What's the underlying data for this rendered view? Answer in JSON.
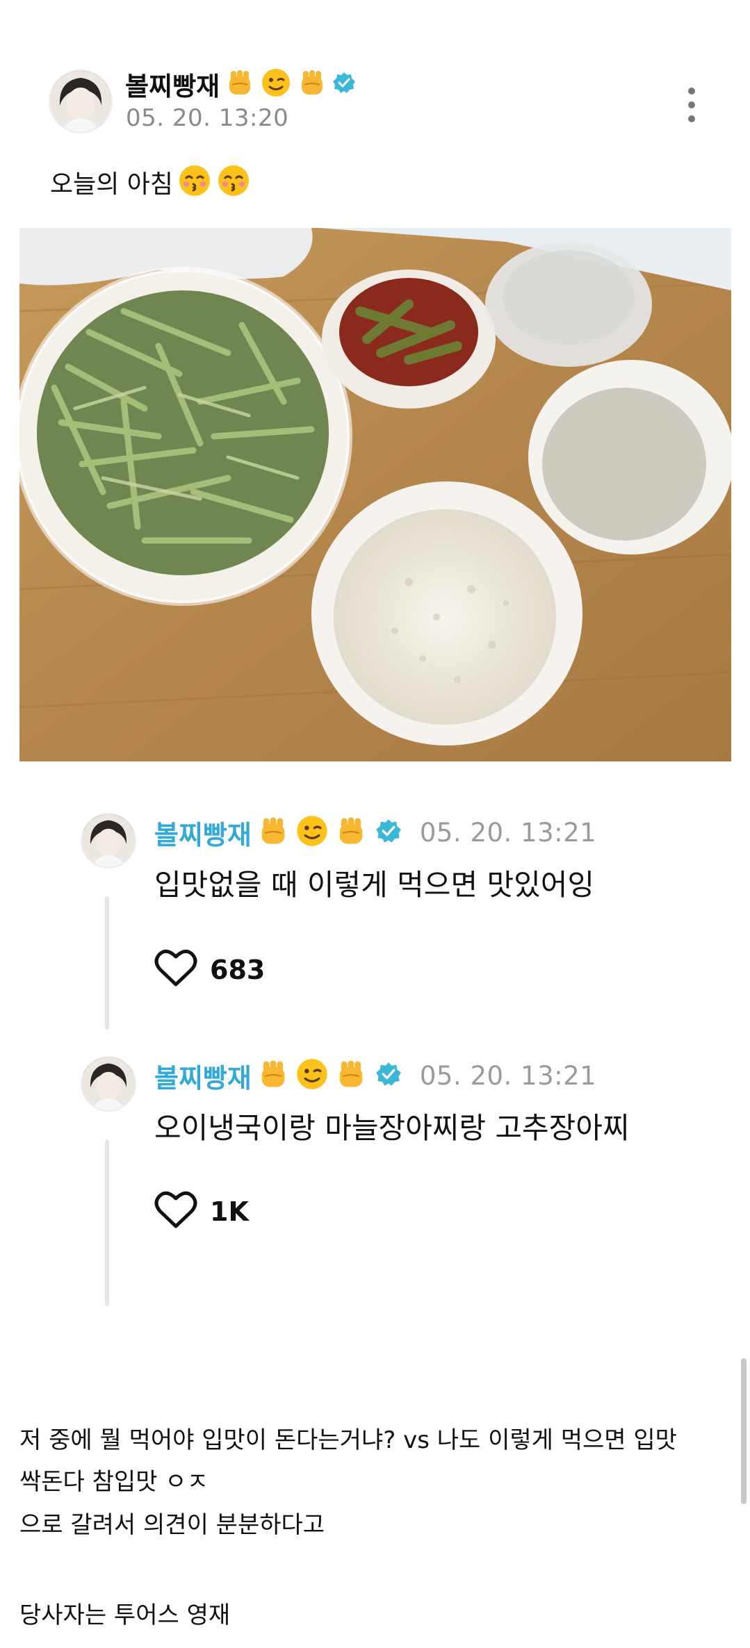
{
  "post": {
    "username": "볼찌빵재",
    "username_emojis": [
      "raised-fist",
      "winking-face",
      "raised-fist"
    ],
    "timestamp": "05. 20. 13:20",
    "caption_text": "오늘의 아침",
    "caption_emojis": [
      "kissing-face-closed-eyes",
      "kissing-face-closed-eyes"
    ],
    "menu_icon": "kebab-menu-icon",
    "photo_subject": "food-photo"
  },
  "replies": [
    {
      "username": "볼찌빵재",
      "timestamp": "05. 20. 13:21",
      "text": "입맛없을 때 이렇게 먹으면 맛있어잉",
      "likes": "683"
    },
    {
      "username": "볼찌빵재",
      "timestamp": "05. 20. 13:21",
      "text": "오이냉국이랑 마늘장아찌랑 고추장아찌",
      "likes": "1K"
    }
  ],
  "commentary": {
    "line1": "저 중에 뭘 먹어야 입맛이 돈다는거냐? vs 나도 이렇게 먹으면 입맛",
    "line2": "싹돈다 참입맛 ㅇㅈ",
    "line3": "으로 갈려서 의견이 분분하다고",
    "line4": "당사자는 투어스 영재"
  },
  "colors": {
    "accent_name": "#33a9d6",
    "verified_badge": "#3bb8d8",
    "timestamp": "#8a8a8a"
  }
}
